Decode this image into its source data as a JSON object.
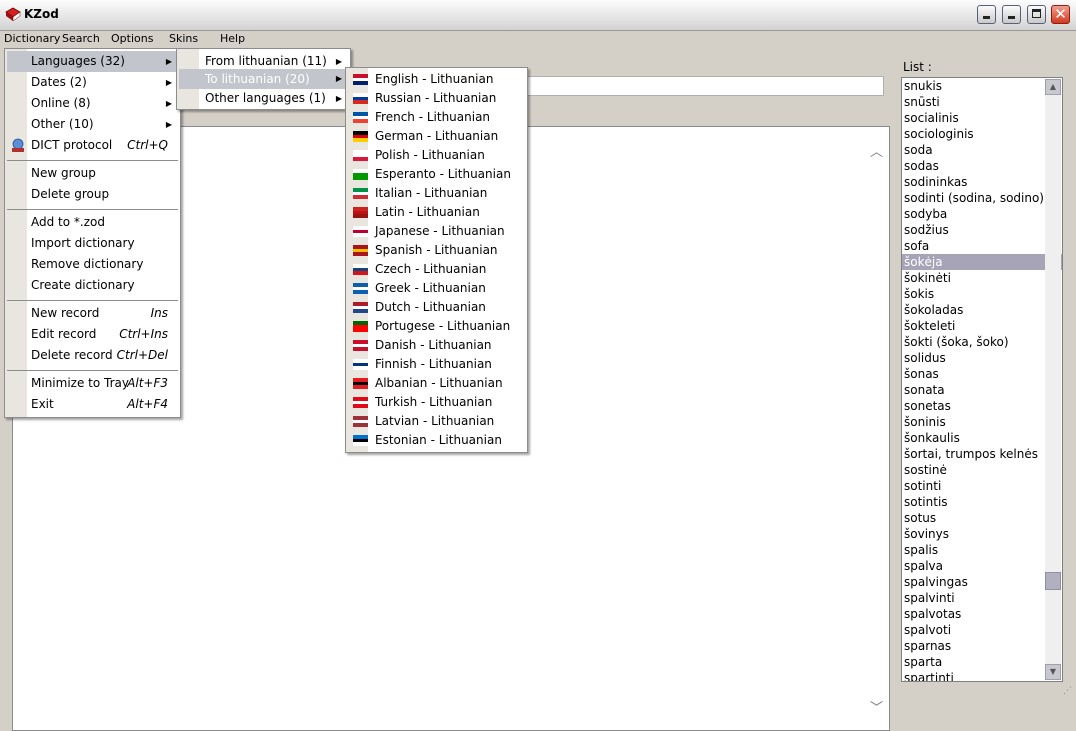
{
  "window": {
    "title": "KZod"
  },
  "menubar": [
    "Dictionary",
    "Search",
    "Options",
    "Skins",
    "Help"
  ],
  "menu1": {
    "items": [
      {
        "label": "Languages (32)",
        "shortcut": "",
        "submenu": true
      },
      {
        "label": "Dates (2)",
        "shortcut": "",
        "submenu": true
      },
      {
        "label": "Online (8)",
        "shortcut": "",
        "submenu": true
      },
      {
        "label": "Other (10)",
        "shortcut": "",
        "submenu": true
      },
      {
        "label": "DICT protocol",
        "shortcut": "Ctrl+Q",
        "submenu": false
      },
      {
        "label": "New group",
        "shortcut": "",
        "submenu": false
      },
      {
        "label": "Delete group",
        "shortcut": "",
        "submenu": false
      },
      {
        "label": "Add to *.zod",
        "shortcut": "",
        "submenu": false
      },
      {
        "label": "Import dictionary",
        "shortcut": "",
        "submenu": false
      },
      {
        "label": "Remove dictionary",
        "shortcut": "",
        "submenu": false
      },
      {
        "label": "Create dictionary",
        "shortcut": "",
        "submenu": false
      },
      {
        "label": "New record",
        "shortcut": "Ins",
        "submenu": false
      },
      {
        "label": "Edit record",
        "shortcut": "Ctrl+Ins",
        "submenu": false
      },
      {
        "label": "Delete record",
        "shortcut": "Ctrl+Del",
        "submenu": false
      },
      {
        "label": "Minimize to Tray",
        "shortcut": "Alt+F3",
        "submenu": false
      },
      {
        "label": "Exit",
        "shortcut": "Alt+F4",
        "submenu": false
      }
    ]
  },
  "menu2": {
    "items": [
      {
        "label": "From lithuanian (11)"
      },
      {
        "label": "To lithuanian (20)"
      },
      {
        "label": "Other languages (1)"
      }
    ]
  },
  "menu3": {
    "items": [
      {
        "label": "English - Lithuanian",
        "flag": [
          "#c8102e",
          "#ffffff",
          "#012169"
        ]
      },
      {
        "label": "Russian - Lithuanian",
        "flag": [
          "#ffffff",
          "#0039a6",
          "#d52b1e"
        ]
      },
      {
        "label": "French - Lithuanian",
        "flag": [
          "#0055a4",
          "#ffffff",
          "#ef4135"
        ]
      },
      {
        "label": "German - Lithuanian",
        "flag": [
          "#000000",
          "#dd0000",
          "#ffce00"
        ]
      },
      {
        "label": "Polish - Lithuanian",
        "flag": [
          "#ffffff",
          "#ffffff",
          "#dc143c"
        ]
      },
      {
        "label": "Esperanto - Lithuanian",
        "flag": [
          "#ffffff",
          "#009900",
          "#009900"
        ]
      },
      {
        "label": "Italian - Lithuanian",
        "flag": [
          "#009246",
          "#ffffff",
          "#ce2b37"
        ]
      },
      {
        "label": "Latin - Lithuanian",
        "flag": [
          "#cc2222",
          "#bb1111",
          "#991111"
        ]
      },
      {
        "label": "Japanese - Lithuanian",
        "flag": [
          "#ffffff",
          "#bc002d",
          "#ffffff"
        ]
      },
      {
        "label": "Spanish - Lithuanian",
        "flag": [
          "#aa151b",
          "#f1bf00",
          "#aa151b"
        ]
      },
      {
        "label": "Czech - Lithuanian",
        "flag": [
          "#ffffff",
          "#11457e",
          "#d7141a"
        ]
      },
      {
        "label": "Greek - Lithuanian",
        "flag": [
          "#0d5eaf",
          "#ffffff",
          "#0d5eaf"
        ]
      },
      {
        "label": "Dutch - Lithuanian",
        "flag": [
          "#ae1c28",
          "#ffffff",
          "#21468b"
        ]
      },
      {
        "label": "Portugese - Lithuanian",
        "flag": [
          "#006600",
          "#ff0000",
          "#ff0000"
        ]
      },
      {
        "label": "Danish - Lithuanian",
        "flag": [
          "#c8102e",
          "#ffffff",
          "#c8102e"
        ]
      },
      {
        "label": "Finnish - Lithuanian",
        "flag": [
          "#ffffff",
          "#003580",
          "#ffffff"
        ]
      },
      {
        "label": "Albanian - Lithuanian",
        "flag": [
          "#e41e20",
          "#000000",
          "#e41e20"
        ]
      },
      {
        "label": "Turkish - Lithuanian",
        "flag": [
          "#e30a17",
          "#ffffff",
          "#e30a17"
        ]
      },
      {
        "label": "Latvian - Lithuanian",
        "flag": [
          "#9e3039",
          "#ffffff",
          "#9e3039"
        ]
      },
      {
        "label": "Estonian - Lithuanian",
        "flag": [
          "#0072ce",
          "#000000",
          "#ffffff"
        ]
      }
    ]
  },
  "list": {
    "label": "List :",
    "items": [
      "snukis",
      "snūsti",
      "socialinis",
      "sociologinis",
      "soda",
      "sodas",
      "sodininkas",
      "sodinti (sodina, sodino)",
      "sodyba",
      "sodžius",
      "sofa",
      "šokėja",
      "šokinėti",
      "šokis",
      "šokoladas",
      "šokteleti",
      "šokti (šoka, šoko)",
      "solidus",
      "šonas",
      "sonata",
      "sonetas",
      "šoninis",
      "šonkaulis",
      "šortai, trumpos kelnės",
      "sostinė",
      "sotinti",
      "sotintis",
      "sotus",
      "šovinys",
      "spalis",
      "spalva",
      "spalvingas",
      "spalvinti",
      "spalvotas",
      "spalvoti",
      "sparnas",
      "sparta",
      "spartinti"
    ],
    "selected": "šokėja"
  }
}
